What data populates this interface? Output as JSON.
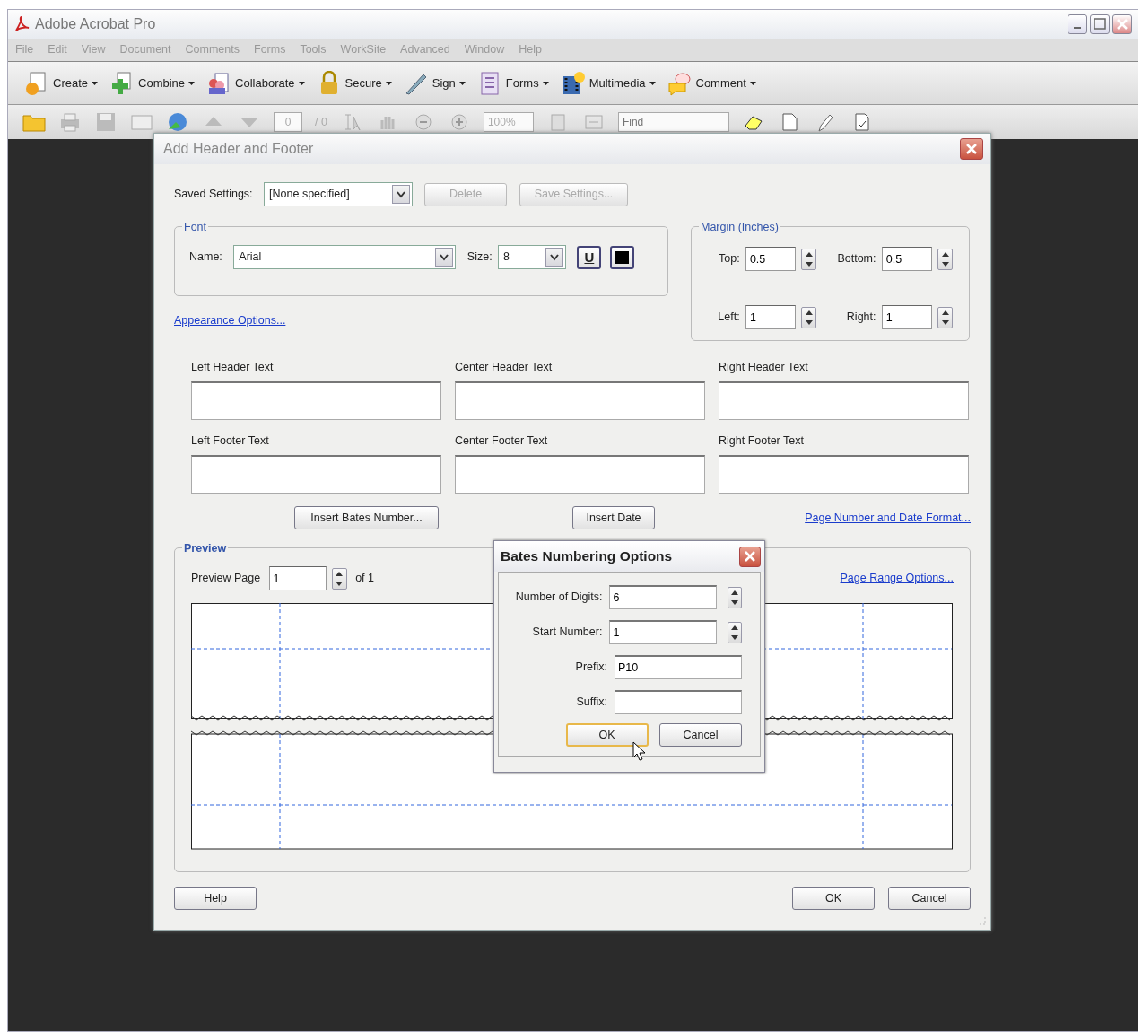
{
  "window": {
    "title": "Adobe Acrobat Pro"
  },
  "menu": [
    "File",
    "Edit",
    "View",
    "Document",
    "Comments",
    "Forms",
    "Tools",
    "WorkSite",
    "Advanced",
    "Window",
    "Help"
  ],
  "toolbar": [
    {
      "label": "Create"
    },
    {
      "label": "Combine"
    },
    {
      "label": "Collaborate"
    },
    {
      "label": "Secure"
    },
    {
      "label": "Sign"
    },
    {
      "label": "Forms"
    },
    {
      "label": "Multimedia"
    },
    {
      "label": "Comment"
    }
  ],
  "toolbar2": {
    "page": "0",
    "page_total": "/ 0",
    "zoom": "100%",
    "find_placeholder": "Find"
  },
  "dialog": {
    "title": "Add Header and Footer",
    "saved_settings": {
      "label": "Saved Settings:",
      "value": "[None specified]"
    },
    "top_buttons": [
      {
        "label": "Delete",
        "disabled": true
      },
      {
        "label": "Save Settings...",
        "disabled": true
      }
    ],
    "font": {
      "legend": "Font",
      "name_label": "Name:",
      "name": "Arial",
      "size_label": "Size:",
      "size": "8",
      "underline": "U",
      "color": "#000000"
    },
    "appearance_link": "Appearance Options...",
    "margin": {
      "legend": "Margin (Inches)",
      "fields": [
        {
          "label": "Top:",
          "value": "0.5"
        },
        {
          "label": "Bottom:",
          "value": "0.5"
        },
        {
          "label": "Left:",
          "value": "1"
        },
        {
          "label": "Right:",
          "value": "1"
        }
      ]
    },
    "header_fields": [
      {
        "label": "Left Header Text"
      },
      {
        "label": "Center Header Text"
      },
      {
        "label": "Right Header Text"
      }
    ],
    "footer_fields": [
      {
        "label": "Left Footer Text"
      },
      {
        "label": "Center Footer Text"
      },
      {
        "label": "Right Footer Text"
      }
    ],
    "insert_buttons": [
      "Insert Bates Number...",
      "Insert Date"
    ],
    "format_link": "Page Number and Date Format...",
    "preview": {
      "legend": "Preview",
      "page_label": "Preview Page",
      "page": "1",
      "of": "of 1",
      "range_link": "Page Range Options..."
    },
    "buttons": [
      "Help",
      "OK",
      "Cancel"
    ]
  },
  "bates": {
    "title": "Bates Numbering Options",
    "fields": [
      {
        "kind": "spinner",
        "label": "Number of Digits:",
        "value": "6"
      },
      {
        "kind": "spinner",
        "label": "Start Number:",
        "value": "1"
      },
      {
        "kind": "text",
        "label": "Prefix:",
        "value": "P10"
      },
      {
        "kind": "text",
        "label": "Suffix:"
      }
    ],
    "buttons": [
      {
        "label": "OK",
        "focused": true
      },
      {
        "label": "Cancel",
        "focused": false
      }
    ]
  }
}
